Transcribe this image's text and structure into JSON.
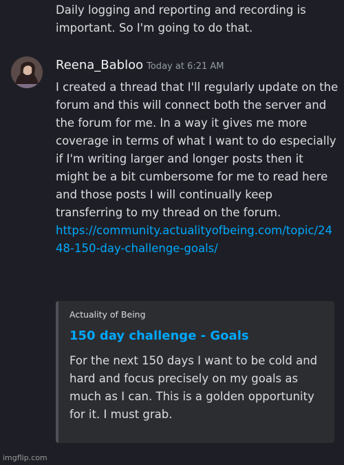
{
  "previous_message": {
    "text": "Daily logging and reporting and recording is important. So I'm going to do that."
  },
  "message": {
    "avatar_icon": "user-avatar",
    "username": "Reena_Babloo",
    "timestamp": "Today at 6:21 AM",
    "text": "I created a thread that I'll regularly update on the forum and this will connect both the server and the forum for me. In a way it gives me more coverage in terms of what I want to do especially if I'm writing larger  and longer posts then it might be a bit cumbersome for me to read here and those posts I will continually keep transferring to my thread on the forum.",
    "link": "https://community.actualityofbeing.com/topic/2448-150-day-challenge-goals/"
  },
  "embed": {
    "provider": "Actuality of Being",
    "title": "150 day challenge - Goals",
    "description": "For the next 150 days I want to be cold and hard and focus precisely on my goals as much as I can. This is a golden opportunity for it. I must grab."
  },
  "watermark": "imgflip.com",
  "colors": {
    "background": "#1e1f26",
    "text": "#dbdee1",
    "link": "#00a8fc",
    "timestamp": "#949ba4",
    "embed_background": "#2b2d31",
    "embed_border": "#4e5058"
  }
}
